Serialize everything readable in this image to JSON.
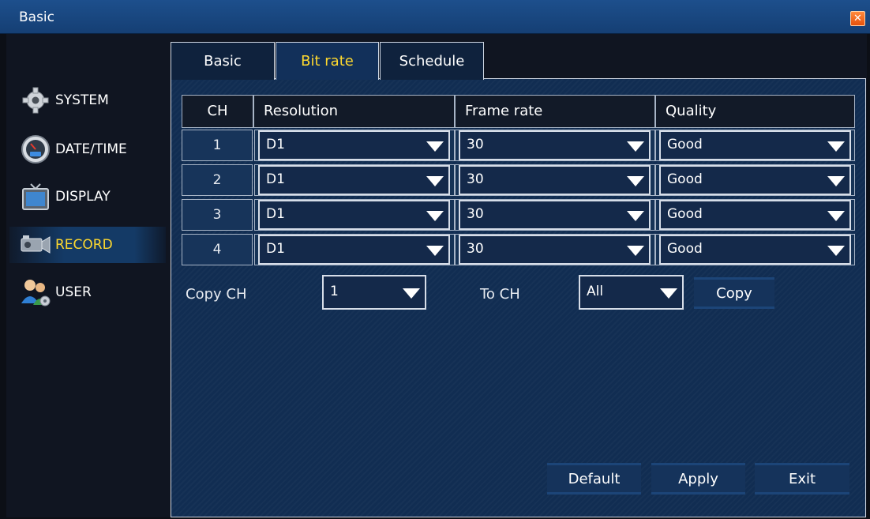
{
  "window": {
    "title": "Basic"
  },
  "sidebar": {
    "items": [
      {
        "label": "SYSTEM",
        "icon": "gear-icon"
      },
      {
        "label": "DATE/TIME",
        "icon": "clock-icon"
      },
      {
        "label": "DISPLAY",
        "icon": "tv-icon"
      },
      {
        "label": "RECORD",
        "icon": "camera-icon",
        "active": true
      },
      {
        "label": "USER",
        "icon": "users-icon"
      }
    ]
  },
  "tabs": [
    {
      "label": "Basic"
    },
    {
      "label": "Bit rate",
      "active": true
    },
    {
      "label": "Schedule"
    }
  ],
  "table": {
    "headers": [
      "CH",
      "Resolution",
      "Frame rate",
      "Quality"
    ],
    "rows": [
      {
        "ch": "1",
        "resolution": "D1",
        "frame_rate": "30",
        "quality": "Good"
      },
      {
        "ch": "2",
        "resolution": "D1",
        "frame_rate": "30",
        "quality": "Good"
      },
      {
        "ch": "3",
        "resolution": "D1",
        "frame_rate": "30",
        "quality": "Good"
      },
      {
        "ch": "4",
        "resolution": "D1",
        "frame_rate": "30",
        "quality": "Good"
      }
    ]
  },
  "copy": {
    "copy_ch_label": "Copy CH",
    "copy_ch_value": "1",
    "to_ch_label": "To CH",
    "to_ch_value": "All",
    "copy_button": "Copy"
  },
  "footer": {
    "default_button": "Default",
    "apply_button": "Apply",
    "exit_button": "Exit"
  },
  "colors": {
    "active_text": "#ffd92e",
    "title_bar": "#1d4f8c",
    "panel_bg": "#112d52"
  }
}
